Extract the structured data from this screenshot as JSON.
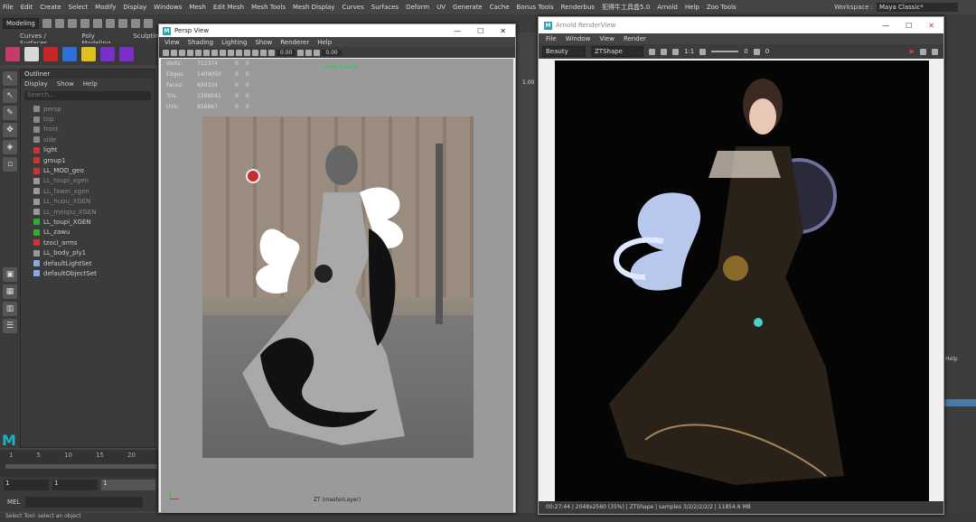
{
  "menubar": [
    "File",
    "Edit",
    "Create",
    "Select",
    "Modify",
    "Display",
    "Windows",
    "Mesh",
    "Edit Mesh",
    "Mesh Tools",
    "Mesh Display",
    "Curves",
    "Surfaces",
    "Deform",
    "UV",
    "Generate",
    "Cache",
    "Bonus Tools",
    "Renderbus",
    "犯得牛工具盒5.0",
    "Arnold",
    "Help",
    "Zoo Tools"
  ],
  "workspace": {
    "label": "Workspace :",
    "value": "Maya Classic*"
  },
  "toolbar": {
    "mode": "Modeling"
  },
  "shelf_tabs": [
    "Curves / Surfaces",
    "Poly Modeling",
    "Sculpting"
  ],
  "outliner": {
    "title": "Outliner",
    "menus": [
      "Display",
      "Show",
      "Help"
    ],
    "search": "Search...",
    "items": [
      {
        "name": "persp",
        "dim": true
      },
      {
        "name": "top",
        "dim": true
      },
      {
        "name": "front",
        "dim": true
      },
      {
        "name": "side",
        "dim": true
      },
      {
        "name": "light",
        "dim": false
      },
      {
        "name": "group1",
        "dim": false
      },
      {
        "name": "LL_MOD_geo",
        "dim": false
      },
      {
        "name": "LL_toupi_xgen",
        "dim": true
      },
      {
        "name": "LL_fawei_xgen",
        "dim": true
      },
      {
        "name": "LL_huou_XGEN",
        "dim": true
      },
      {
        "name": "LL_meiqiu_XGEN",
        "dim": true
      },
      {
        "name": "LL_toupi_XGEN",
        "dim": false
      },
      {
        "name": "LL_zawu",
        "dim": false
      },
      {
        "name": "tzoci_arms",
        "dim": false
      },
      {
        "name": "LL_body_ply1",
        "dim": false
      },
      {
        "name": "defaultLightSet",
        "dim": false
      },
      {
        "name": "defaultObjectSet",
        "dim": false
      }
    ]
  },
  "timeline": {
    "ticks": [
      "1",
      "5",
      "10",
      "15",
      "20"
    ],
    "range": [
      "1",
      "1",
      "1"
    ]
  },
  "mel": {
    "label": "MEL"
  },
  "status": "Select Tool: select an object",
  "persp": {
    "title": "Persp View",
    "menus": [
      "View",
      "Shading",
      "Lighting",
      "Show",
      "Renderer",
      "Help"
    ],
    "field1": "0.00",
    "field2": "1.00",
    "side_value": "1.00",
    "hud": [
      [
        "Verts:",
        "712374",
        "0",
        "0"
      ],
      [
        "Edges:",
        "1409050",
        "0",
        "0"
      ],
      [
        "Faces:",
        "699334",
        "0",
        "0"
      ],
      [
        "Tris:",
        "1398042",
        "0",
        "0"
      ],
      [
        "UVs:",
        "856867",
        "0",
        "0"
      ]
    ],
    "resolution": "2048 x 2560",
    "camera": "ZT (masterLayer)"
  },
  "arnold": {
    "title": "Arnold RenderView",
    "menus": [
      "File",
      "Window",
      "View",
      "Render"
    ],
    "aov": "Beauty",
    "camera": "ZTShape",
    "ratio": "1:1",
    "exposure": "0",
    "gamma": "0",
    "status": "00:27:44 | 2048x2560 (35%) | ZTShape | samples 3/2/2/2/2/2 | 11854.6 MB"
  },
  "right_dock": {
    "help": "Help"
  }
}
